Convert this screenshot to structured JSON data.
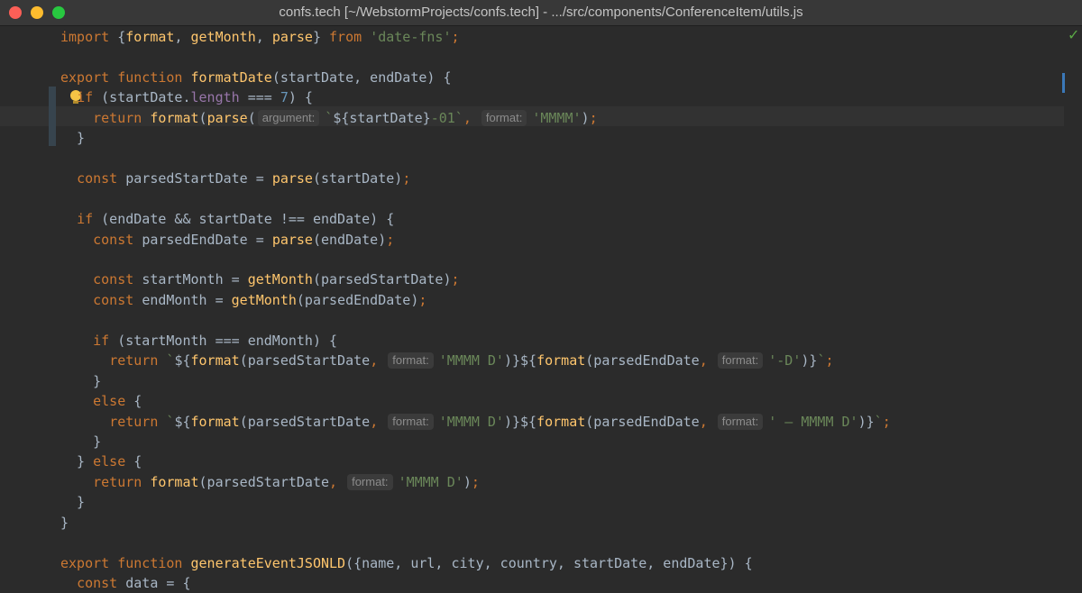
{
  "window": {
    "title": "confs.tech [~/WebstormProjects/confs.tech] - .../src/components/ConferenceItem/utils.js"
  },
  "editor": {
    "lines": [
      [
        [
          "kw",
          "import"
        ],
        [
          "p",
          " {"
        ],
        [
          "fn",
          "format"
        ],
        [
          "p",
          ", "
        ],
        [
          "fn",
          "getMonth"
        ],
        [
          "p",
          ", "
        ],
        [
          "fn",
          "parse"
        ],
        [
          "p",
          "} "
        ],
        [
          "kw",
          "from"
        ],
        [
          "p",
          " "
        ],
        [
          "str",
          "'date-fns'"
        ],
        [
          "kw",
          ";"
        ]
      ],
      [],
      [
        [
          "kw",
          "export function "
        ],
        [
          "fn",
          "formatDate"
        ],
        [
          "p",
          "(startDate, endDate) {"
        ]
      ],
      [
        [
          "p",
          "  "
        ],
        [
          "kw",
          "if"
        ],
        [
          "p",
          " (startDate."
        ],
        [
          "prop",
          "length"
        ],
        [
          "p",
          " === "
        ],
        [
          "num",
          "7"
        ],
        [
          "p",
          ") {"
        ]
      ],
      [
        [
          "p",
          "    "
        ],
        [
          "kw",
          "return "
        ],
        [
          "fn",
          "format"
        ],
        [
          "p",
          "("
        ],
        [
          "fn",
          "parse"
        ],
        [
          "p",
          "("
        ],
        [
          "hint",
          "argument:"
        ],
        [
          "str",
          "`"
        ],
        [
          "p",
          "${startDate}"
        ],
        [
          "str",
          "-01`"
        ],
        [
          "kw",
          ","
        ],
        [
          "p",
          " "
        ],
        [
          "hint",
          "format:"
        ],
        [
          "str",
          "'MMMM'"
        ],
        [
          "p",
          ")"
        ],
        [
          "kw",
          ";"
        ]
      ],
      [
        [
          "p",
          "  }"
        ]
      ],
      [],
      [
        [
          "p",
          "  "
        ],
        [
          "kw",
          "const "
        ],
        [
          "p",
          "parsedStartDate = "
        ],
        [
          "fn",
          "parse"
        ],
        [
          "p",
          "(startDate)"
        ],
        [
          "kw",
          ";"
        ]
      ],
      [],
      [
        [
          "p",
          "  "
        ],
        [
          "kw",
          "if"
        ],
        [
          "p",
          " (endDate && startDate !== endDate) {"
        ]
      ],
      [
        [
          "p",
          "    "
        ],
        [
          "kw",
          "const "
        ],
        [
          "p",
          "parsedEndDate = "
        ],
        [
          "fn",
          "parse"
        ],
        [
          "p",
          "(endDate)"
        ],
        [
          "kw",
          ";"
        ]
      ],
      [],
      [
        [
          "p",
          "    "
        ],
        [
          "kw",
          "const "
        ],
        [
          "p",
          "startMonth = "
        ],
        [
          "fn",
          "getMonth"
        ],
        [
          "p",
          "(parsedStartDate)"
        ],
        [
          "kw",
          ";"
        ]
      ],
      [
        [
          "p",
          "    "
        ],
        [
          "kw",
          "const "
        ],
        [
          "p",
          "endMonth = "
        ],
        [
          "fn",
          "getMonth"
        ],
        [
          "p",
          "(parsedEndDate)"
        ],
        [
          "kw",
          ";"
        ]
      ],
      [],
      [
        [
          "p",
          "    "
        ],
        [
          "kw",
          "if"
        ],
        [
          "p",
          " (startMonth === endMonth) {"
        ]
      ],
      [
        [
          "p",
          "      "
        ],
        [
          "kw",
          "return "
        ],
        [
          "str",
          "`"
        ],
        [
          "p",
          "${"
        ],
        [
          "fn",
          "format"
        ],
        [
          "p",
          "(parsedStartDate"
        ],
        [
          "kw",
          ","
        ],
        [
          "p",
          " "
        ],
        [
          "hint",
          "format:"
        ],
        [
          "str",
          "'MMMM D'"
        ],
        [
          "p",
          ")}${"
        ],
        [
          "fn",
          "format"
        ],
        [
          "p",
          "(parsedEndDate"
        ],
        [
          "kw",
          ","
        ],
        [
          "p",
          " "
        ],
        [
          "hint",
          "format:"
        ],
        [
          "str",
          "'-D'"
        ],
        [
          "p",
          ")}"
        ],
        [
          "str",
          "`"
        ],
        [
          "kw",
          ";"
        ]
      ],
      [
        [
          "p",
          "    }"
        ]
      ],
      [
        [
          "p",
          "    "
        ],
        [
          "kw",
          "else"
        ],
        [
          "p",
          " {"
        ]
      ],
      [
        [
          "p",
          "      "
        ],
        [
          "kw",
          "return "
        ],
        [
          "str",
          "`"
        ],
        [
          "p",
          "${"
        ],
        [
          "fn",
          "format"
        ],
        [
          "p",
          "(parsedStartDate"
        ],
        [
          "kw",
          ","
        ],
        [
          "p",
          " "
        ],
        [
          "hint",
          "format:"
        ],
        [
          "str",
          "'MMMM D'"
        ],
        [
          "p",
          ")}${"
        ],
        [
          "fn",
          "format"
        ],
        [
          "p",
          "(parsedEndDate"
        ],
        [
          "kw",
          ","
        ],
        [
          "p",
          " "
        ],
        [
          "hint",
          "format:"
        ],
        [
          "str",
          "' – MMMM D'"
        ],
        [
          "p",
          ")}"
        ],
        [
          "str",
          "`"
        ],
        [
          "kw",
          ";"
        ]
      ],
      [
        [
          "p",
          "    }"
        ]
      ],
      [
        [
          "p",
          "  } "
        ],
        [
          "kw",
          "else"
        ],
        [
          "p",
          " {"
        ]
      ],
      [
        [
          "p",
          "    "
        ],
        [
          "kw",
          "return "
        ],
        [
          "fn",
          "format"
        ],
        [
          "p",
          "(parsedStartDate"
        ],
        [
          "kw",
          ","
        ],
        [
          "p",
          " "
        ],
        [
          "hint",
          "format:"
        ],
        [
          "str",
          "'MMMM D'"
        ],
        [
          "p",
          ")"
        ],
        [
          "kw",
          ";"
        ]
      ],
      [
        [
          "p",
          "  }"
        ]
      ],
      [
        [
          "p",
          "}"
        ]
      ],
      [],
      [
        [
          "kw",
          "export function "
        ],
        [
          "fn",
          "generateEventJSONLD"
        ],
        [
          "p",
          "({name, url, city, country, startDate, endDate}) {"
        ]
      ],
      [
        [
          "p",
          "  "
        ],
        [
          "kw",
          "const "
        ],
        [
          "p",
          "data = {"
        ]
      ]
    ]
  },
  "colors": {
    "keyword": "#cc7832",
    "function": "#ffc66d",
    "string": "#6a8759",
    "number": "#6897bb",
    "property": "#9876aa",
    "text": "#a9b7c6"
  },
  "icons": {
    "intention": "lightbulb-icon",
    "status": "checkmark-icon"
  }
}
